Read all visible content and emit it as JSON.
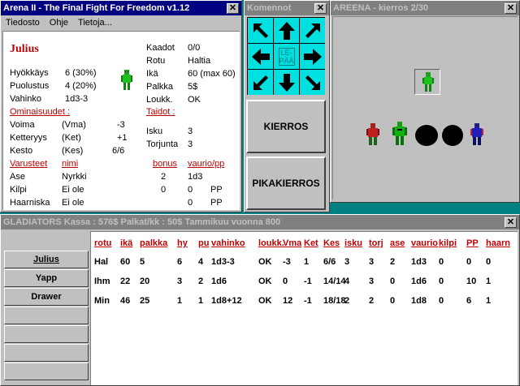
{
  "main_window": {
    "title": "Arena II - The Final Fight For Freedom v1.12",
    "close": "✕",
    "menu": [
      "Tiedosto",
      "Ohje",
      "Tietoja..."
    ],
    "name": "Julius",
    "stats_left": [
      {
        "label": "Hyökkäys",
        "value": "6  (30%)"
      },
      {
        "label": "Puolustus",
        "value": "4  (20%)"
      },
      {
        "label": "Vahinko",
        "value": "1d3-3"
      }
    ],
    "stats_right": [
      {
        "label": "Kaadot",
        "value": "0/0"
      },
      {
        "label": "Rotu",
        "value": "Haltia"
      },
      {
        "label": "Ikä",
        "value": "60 (max 60)"
      },
      {
        "label": "Palkka",
        "value": "5$"
      },
      {
        "label": "Loukk.",
        "value": "OK"
      }
    ],
    "attributes_header": "Ominaisuudet :",
    "attributes": [
      {
        "label": "Voima",
        "abbr": "(Vma)",
        "value": "-3"
      },
      {
        "label": "Ketteryys",
        "abbr": "(Ket)",
        "value": "+1"
      },
      {
        "label": "Kesto",
        "abbr": "(Kes)",
        "value": "6/6"
      }
    ],
    "skills_header": "Taidot :",
    "skills": [
      {
        "label": "Isku",
        "value": "3"
      },
      {
        "label": "Torjunta",
        "value": "3"
      }
    ],
    "equipment_headers": [
      "Varusteet",
      "nimi",
      "bonus",
      "vaurio/pp"
    ],
    "equipment": [
      {
        "slot": "Ase",
        "name": "Nyrkki",
        "bonus": "2",
        "damage": "1d3",
        "pp": ""
      },
      {
        "slot": "Kilpi",
        "name": "Ei ole",
        "bonus": "0",
        "damage": "0",
        "pp": "PP"
      },
      {
        "slot": "Haarniska",
        "name": "Ei ole",
        "bonus": "",
        "damage": "0",
        "pp": "PP"
      }
    ]
  },
  "command_window": {
    "title": "Komennot",
    "close": "✕",
    "center_label": "LE-PÄÄ",
    "round_button": "KIERROS",
    "quick_round_button": "PIKAKIERROS"
  },
  "arena_window": {
    "title": "AREENA  -  kierros 2/30",
    "close": "✕"
  },
  "gladiators_window": {
    "title": "GLADIATORS   Kassa : 576$  Palkat/kk : 50$   Tammikuu vuonna 800",
    "close": "✕",
    "names": [
      "Julius",
      "Yapp",
      "Drawer"
    ],
    "columns": [
      "rotu",
      "ikä",
      "palkka",
      "hy",
      "pu",
      "vahinko",
      "loukk.",
      "Vma",
      "Ket",
      "Kes",
      "isku",
      "torj",
      "ase",
      "vaurio",
      "kilpi",
      "PP",
      "haarn"
    ],
    "rows": [
      [
        "Hal",
        "60",
        "5",
        "6",
        "4",
        "1d3-3",
        "OK",
        "-3",
        "1",
        "6/6",
        "3",
        "3",
        "2",
        "1d3",
        "0",
        "0",
        "0"
      ],
      [
        "Ihm",
        "22",
        "20",
        "3",
        "2",
        "1d6",
        "OK",
        "0",
        "-1",
        "14/14",
        "4",
        "3",
        "0",
        "1d6",
        "0",
        "10",
        "1"
      ],
      [
        "Min",
        "46",
        "25",
        "1",
        "1",
        "1d8+12",
        "OK",
        "12",
        "-1",
        "18/18",
        "2",
        "2",
        "0",
        "1d8",
        "0",
        "6",
        "1"
      ]
    ]
  },
  "colors": {
    "desktop": "#008080",
    "title_active": "#000080",
    "accent_red": "#c00000",
    "dpad": "#00e0e0"
  }
}
